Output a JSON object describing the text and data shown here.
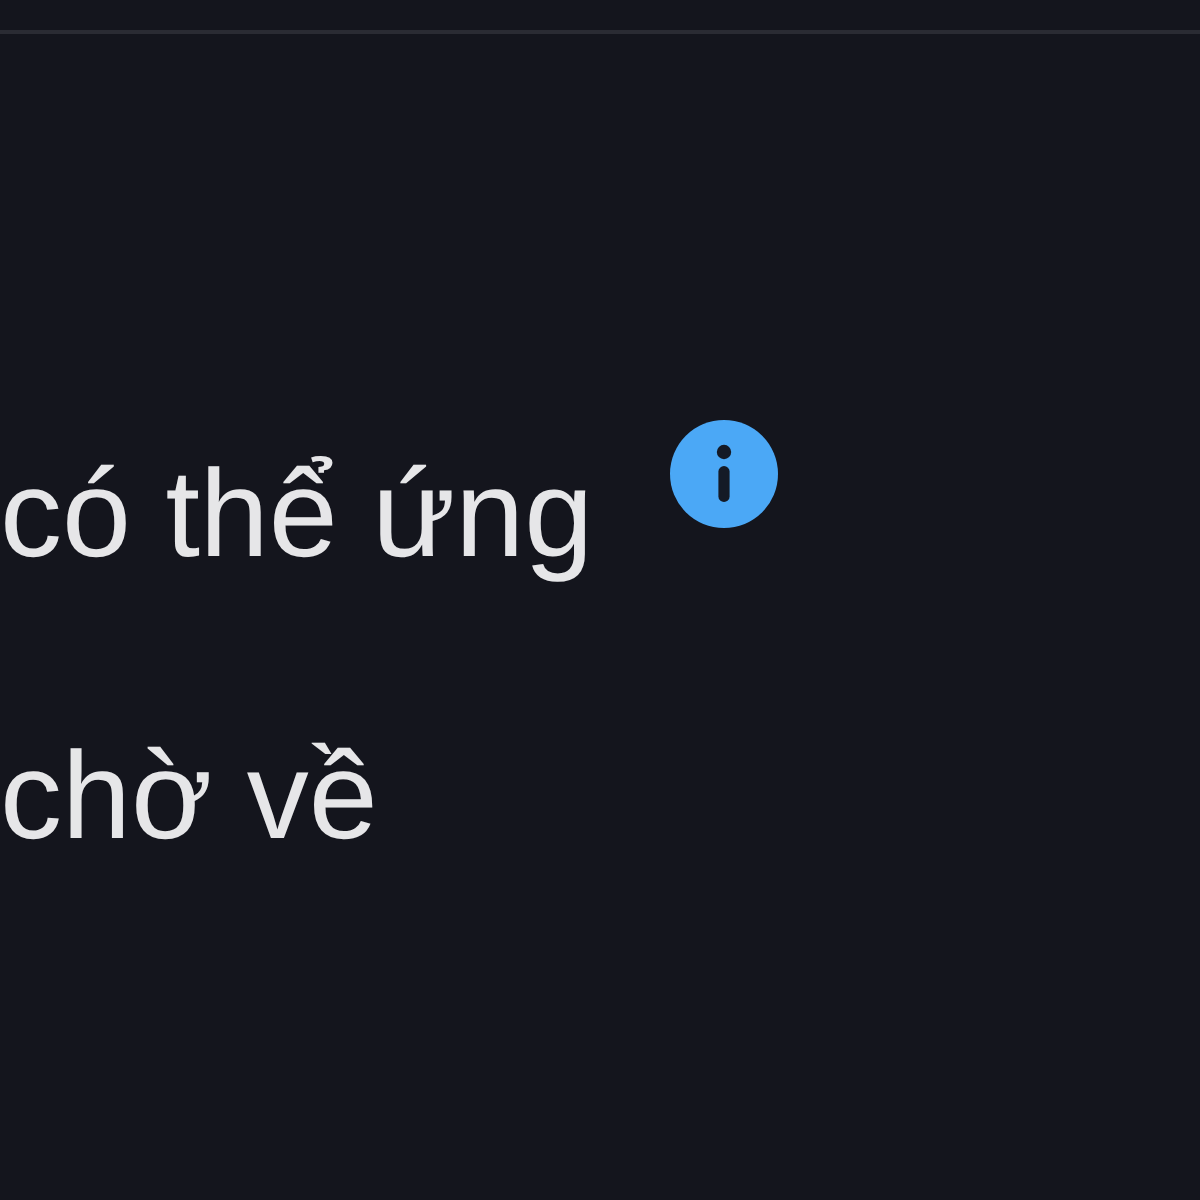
{
  "rows": [
    {
      "label": "có thể ứng",
      "info_icon": true
    },
    {
      "label": "chờ về",
      "info_icon": false
    }
  ]
}
